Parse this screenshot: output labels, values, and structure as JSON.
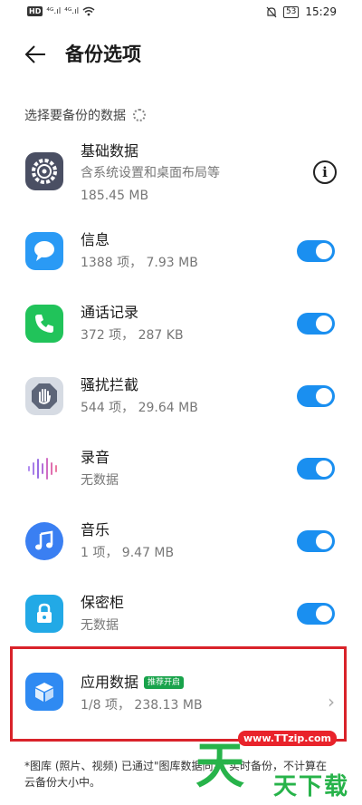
{
  "status_bar": {
    "left_badge": "HD",
    "signal1": "⁴ᴳ.ıl",
    "signal2": "⁴ᴳ.ıl",
    "battery": "53",
    "time": "15:29"
  },
  "header": {
    "title": "备份选项"
  },
  "section_label": "选择要备份的数据",
  "rows": [
    {
      "name": "基础数据",
      "sub1": "含系统设置和桌面布局等",
      "sub2": "185.45 MB"
    },
    {
      "name": "信息",
      "sub": "1388 项， 7.93 MB",
      "toggle": true
    },
    {
      "name": "通话记录",
      "sub": "372 项， 287 KB",
      "toggle": true
    },
    {
      "name": "骚扰拦截",
      "sub": "544 项， 29.64 MB",
      "toggle": true
    },
    {
      "name": "录音",
      "sub": "无数据",
      "toggle": true
    },
    {
      "name": "音乐",
      "sub": "1 项， 9.47 MB",
      "toggle": true
    },
    {
      "name": "保密柜",
      "sub": "无数据",
      "toggle": true
    },
    {
      "name": "应用数据",
      "badge": "推荐开启",
      "sub": "1/8 项， 238.13 MB"
    }
  ],
  "footnote": "*图库 (照片、视频) 已通过\"图库数据同步\"实时备份，不计算在云备份大小中。",
  "watermark": {
    "url": "www.TTzip.com",
    "big": "天",
    "text": "天下载"
  },
  "colors": {
    "toggle_on": "#1a8ff0",
    "highlight": "#d9232a",
    "badge": "#19a34b"
  }
}
